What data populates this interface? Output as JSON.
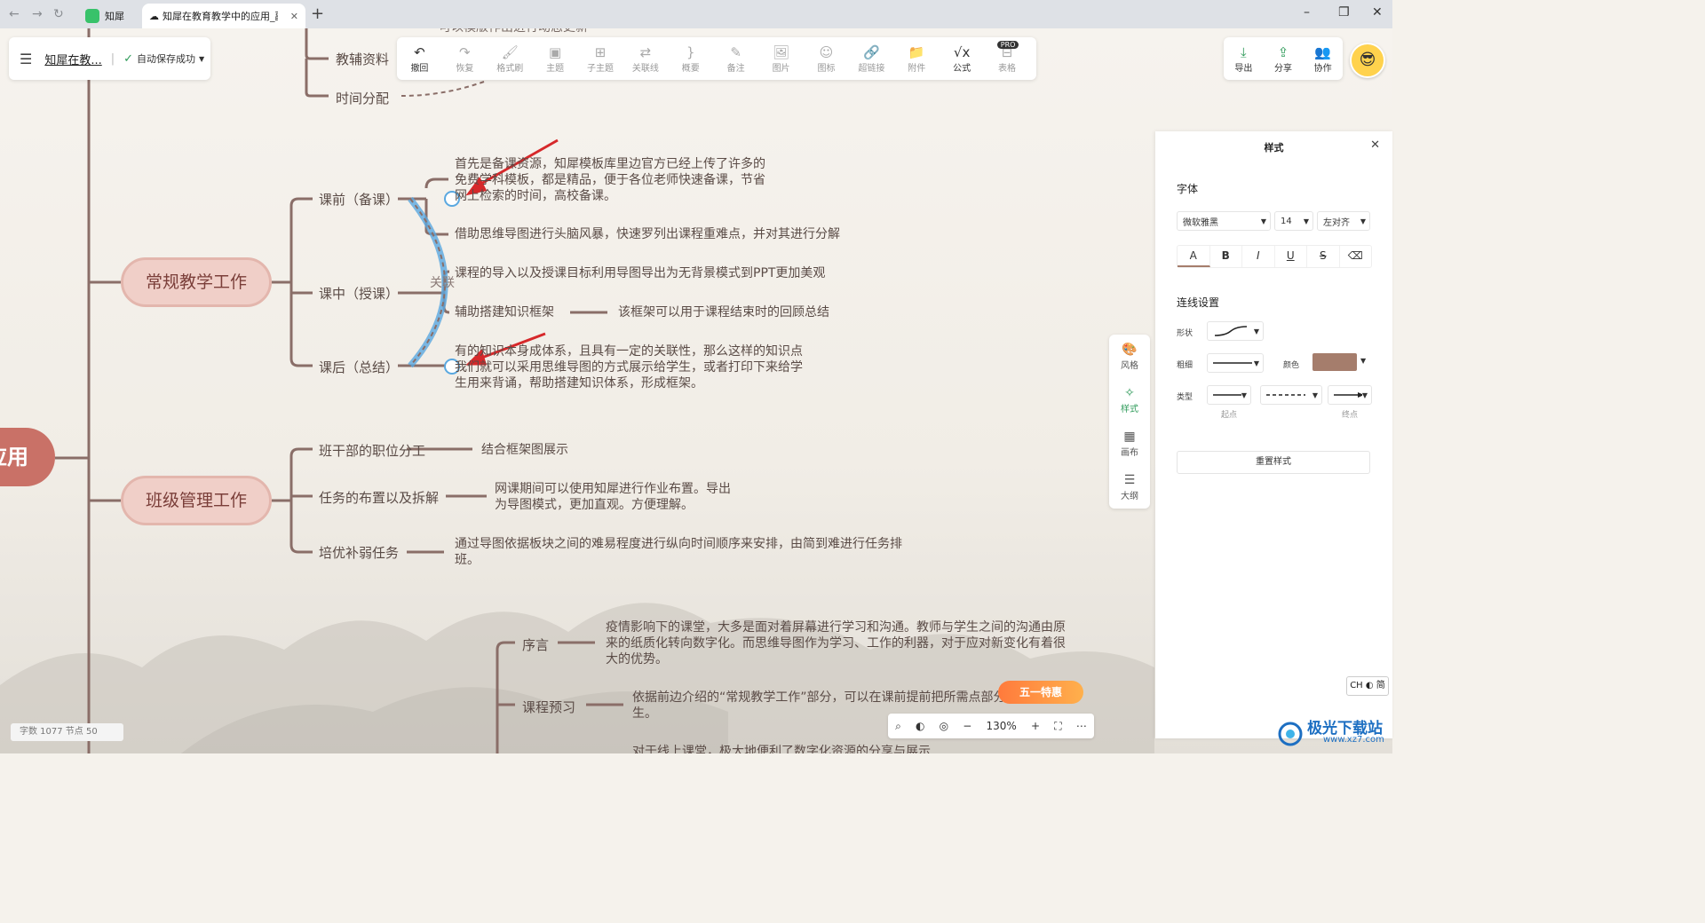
{
  "browser": {
    "back": "←",
    "forward": "→",
    "reload": "↻",
    "tabs": [
      {
        "label": "知犀"
      },
      {
        "label": "知犀在教育教学中的应用_副本"
      }
    ],
    "new_tab": "+",
    "win_min": "–",
    "win_max": "❐",
    "win_close": "✕"
  },
  "header": {
    "doc_title": "知犀在教...",
    "save_status": "自动保存成功"
  },
  "toolbar": [
    {
      "icon": "undo-icon",
      "glyph": "↶",
      "label": "撤回",
      "active": true
    },
    {
      "icon": "redo-icon",
      "glyph": "↷",
      "label": "恢复",
      "active": false
    },
    {
      "icon": "format-brush-icon",
      "glyph": "🖌",
      "label": "格式刷",
      "active": false
    },
    {
      "icon": "topic-icon",
      "glyph": "▣",
      "label": "主题",
      "active": false
    },
    {
      "icon": "subtopic-icon",
      "glyph": "⊞",
      "label": "子主题",
      "active": false
    },
    {
      "icon": "relation-icon",
      "glyph": "⇄",
      "label": "关联线",
      "active": false
    },
    {
      "icon": "summary-icon",
      "glyph": "}",
      "label": "概要",
      "active": false
    },
    {
      "icon": "note-icon",
      "glyph": "✎",
      "label": "备注",
      "active": false
    },
    {
      "icon": "image-icon",
      "glyph": "🖼",
      "label": "图片",
      "active": false
    },
    {
      "icon": "emoji-icon",
      "glyph": "☺",
      "label": "图标",
      "active": false
    },
    {
      "icon": "link-icon",
      "glyph": "🔗",
      "label": "超链接",
      "active": false
    },
    {
      "icon": "attachment-icon",
      "glyph": "📁",
      "label": "附件",
      "active": false
    },
    {
      "icon": "formula-icon",
      "glyph": "√x",
      "label": "公式",
      "active": true
    },
    {
      "icon": "table-icon",
      "glyph": "⊟",
      "label": "表格",
      "active": false,
      "badge": "PRO"
    }
  ],
  "right_actions": [
    {
      "icon": "export-icon",
      "glyph": "⤓",
      "label": "导出"
    },
    {
      "icon": "share-icon",
      "glyph": "⇪",
      "label": "分享"
    },
    {
      "icon": "collab-icon",
      "glyph": "👥",
      "label": "协作"
    }
  ],
  "side_strip": [
    {
      "icon": "palette-icon",
      "glyph": "🎨",
      "label": "风格",
      "active": false
    },
    {
      "icon": "style-icon",
      "glyph": "✧",
      "label": "样式",
      "active": true
    },
    {
      "icon": "canvas-icon",
      "glyph": "▦",
      "label": "画布",
      "active": false
    },
    {
      "icon": "outline-icon",
      "glyph": "☰",
      "label": "大纲",
      "active": false
    }
  ],
  "style_panel": {
    "title": "样式",
    "close": "✕",
    "font_section": "字体",
    "font_family": "微软雅黑",
    "font_size": "14",
    "align": "左对齐",
    "format_buttons": [
      {
        "name": "font-color-button",
        "glyph": "A"
      },
      {
        "name": "bold-button",
        "glyph": "B"
      },
      {
        "name": "italic-button",
        "glyph": "I"
      },
      {
        "name": "underline-button",
        "glyph": "U"
      },
      {
        "name": "strikethrough-button",
        "glyph": "S"
      },
      {
        "name": "clear-format-button",
        "glyph": "⌫"
      }
    ],
    "line_section": "连线设置",
    "shape_label": "形状",
    "thickness_label": "粗细",
    "color_label": "颜色",
    "color_value": "#a57d6c",
    "type_label": "类型",
    "start_label": "起点",
    "end_label": "终点",
    "reset": "重置样式"
  },
  "mindmap": {
    "root": "应用",
    "top_cut_text": "可以模版作出进行动态更新",
    "misc_nodes": [
      "教辅资料",
      "时间分配"
    ],
    "relation_label": "关联",
    "branch1": {
      "title": "常规教学工作",
      "children": [
        "课前（备课）",
        "课中（授课）",
        "课后（总结）"
      ],
      "notes": [
        "首先是备课资源，知犀模板库里边官方已经上传了许多的免费学科模板，都是精品，便于各位老师快速备课，节省网上检索的时间，高校备课。",
        "借助思维导图进行头脑风暴，快速罗列出课程重难点，并对其进行分解",
        "课程的导入以及授课目标利用导图导出为无背景模式到PPT更加美观",
        "辅助搭建知识框架",
        "该框架可以用于课程结束时的回顾总结",
        "有的知识本身成体系，且具有一定的关联性，那么这样的知识点我们就可以采用思维导图的方式展示给学生，或者打印下来给学生用来背诵，帮助搭建知识体系，形成框架。"
      ]
    },
    "branch2": {
      "title": "班级管理工作",
      "children": [
        "班干部的职位分工",
        "任务的布置以及拆解",
        "培优补弱任务"
      ],
      "notes": [
        "结合框架图展示",
        "网课期间可以使用知犀进行作业布置。导出为导图模式，更加直观。方便理解。",
        "通过导图依据板块之间的难易程度进行纵向时间顺序来安排，由简到难进行任务排班。"
      ]
    },
    "branch3": {
      "children": [
        "序言",
        "课程预习"
      ],
      "notes": [
        "疫情影响下的课堂，大多是面对着屏幕进行学习和沟通。教师与学生之间的沟通由原来的纸质化转向数字化。而思维导图作为学习、工作的利器，对于应对新变化有着很大的优势。",
        "依据前边介绍的“常规教学工作”部分，可以在课前提前把所需点部分提前分享给学生。",
        "对于线上课堂，极大地便利了数字化资源的分享与展示"
      ]
    }
  },
  "stats": {
    "text": "字数 1077    节点 50"
  },
  "zoom": {
    "value": "130%",
    "minus": "−",
    "plus": "+"
  },
  "promo": {
    "text": "五一特惠"
  },
  "ime": {
    "text": "CH ◐ 简"
  },
  "watermark": {
    "text": "极光下载站",
    "sub": "www.xz7.com"
  }
}
